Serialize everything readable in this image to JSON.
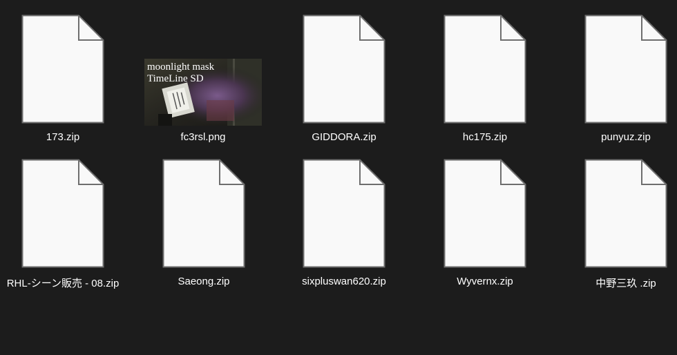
{
  "files": [
    {
      "name": "173.zip",
      "icon": "blank-file-icon"
    },
    {
      "name": "fc3rsl.png",
      "icon": "image-thumbnail",
      "thumbnail_text": [
        "moonlight mask",
        "TimeLine SD"
      ]
    },
    {
      "name": "GIDDORA.zip",
      "icon": "blank-file-icon"
    },
    {
      "name": "hc175.zip",
      "icon": "blank-file-icon"
    },
    {
      "name": "punyuz.zip",
      "icon": "blank-file-icon"
    },
    {
      "name": "RHL-シーン販売 - 08.zip",
      "icon": "blank-file-icon"
    },
    {
      "name": "Saeong.zip",
      "icon": "blank-file-icon"
    },
    {
      "name": "sixpluswan620.zip",
      "icon": "blank-file-icon"
    },
    {
      "name": "Wyvernx.zip",
      "icon": "blank-file-icon"
    },
    {
      "name": "中野三玖 .zip",
      "icon": "blank-file-icon"
    }
  ],
  "colors": {
    "background": "#1c1c1c",
    "icon_fill": "#f9f9f9",
    "icon_stroke": "#6e6e6e",
    "label_text": "#ffffff"
  }
}
